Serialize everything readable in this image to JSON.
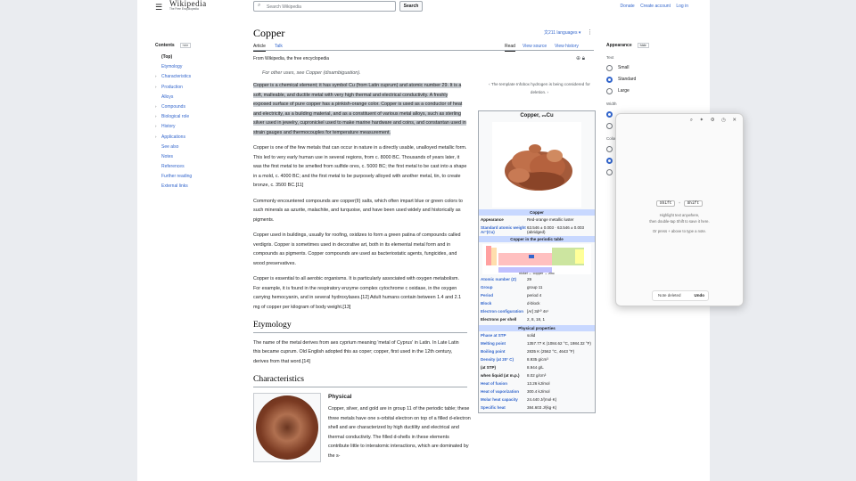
{
  "header": {
    "wordmark": "Wikipedia",
    "tagline": "The Free Encyclopedia",
    "search_placeholder": "Search Wikipedia",
    "search_button": "Search",
    "user_links": [
      "Donate",
      "Create account",
      "Log in"
    ]
  },
  "toc": {
    "title": "Contents",
    "hide": "hide",
    "items": [
      {
        "label": "(Top)",
        "current": true,
        "expandable": false
      },
      {
        "label": "Etymology",
        "expandable": false
      },
      {
        "label": "Characteristics",
        "expandable": true
      },
      {
        "label": "Production",
        "expandable": true
      },
      {
        "label": "Alloys",
        "expandable": false
      },
      {
        "label": "Compounds",
        "expandable": true
      },
      {
        "label": "Biological role",
        "expandable": true
      },
      {
        "label": "History",
        "expandable": true
      },
      {
        "label": "Applications",
        "expandable": true
      },
      {
        "label": "See also",
        "expandable": false
      },
      {
        "label": "Notes",
        "expandable": false
      },
      {
        "label": "References",
        "expandable": false
      },
      {
        "label": "Further reading",
        "expandable": false
      },
      {
        "label": "External links",
        "expandable": false
      }
    ]
  },
  "article": {
    "title": "Copper",
    "languages": "211 languages",
    "tabs_left": [
      "Article",
      "Talk"
    ],
    "tabs_right": [
      "Read",
      "View source",
      "View history"
    ],
    "from": "From Wikipedia, the free encyclopedia",
    "hatnote": "For other uses, see Copper (disambiguation).",
    "p1": "Copper is a chemical element; it has symbol Cu (from Latin cuprum) and atomic number 29. It is a soft, malleable, and ductile metal with very high thermal and electrical conductivity. A freshly exposed surface of pure copper has a pinkish-orange color. Copper is used as a conductor of heat and electricity, as a building material, and as a constituent of various metal alloys, such as sterling silver used in jewelry, cupronickel used to make marine hardware and coins, and constantan used in strain gauges and thermocouples for temperature measurement.",
    "p2": "Copper is one of the few metals that can occur in nature in a directly usable, unalloyed metallic form. This led to very early human use in several regions, from c. 8000 BC. Thousands of years later, it was the first metal to be smelted from sulfide ores, c. 5000 BC; the first metal to be cast into a shape in a mold, c. 4000 BC; and the first metal to be purposely alloyed with another metal, tin, to create bronze, c. 3500 BC.[11]",
    "p3": "Commonly encountered compounds are copper(II) salts, which often impart blue or green colors to such minerals as azurite, malachite, and turquoise, and have been used widely and historically as pigments.",
    "p4": "Copper used in buildings, usually for roofing, oxidizes to form a green patina of compounds called verdigris. Copper is sometimes used in decorative art, both in its elemental metal form and in compounds as pigments. Copper compounds are used as bacteriostatic agents, fungicides, and wood preservatives.",
    "p5": "Copper is essential to all aerobic organisms. It is particularly associated with oxygen metabolism. For example, it is found in the respiratory enzyme complex cytochrome c oxidase, in the oxygen carrying hemocyanin, and in several hydroxylases.[12] Adult humans contain between 1.4 and 2.1 mg of copper per kilogram of body weight.[13]",
    "etym_heading": "Etymology",
    "etym": "The name of the metal derives from aes cyprium meaning 'metal of Cyprus' in Latin. In Late Latin this became cuprum. Old English adopted this as coper; copper, first used in the 12th century, derives from that word.[14]",
    "char_heading": "Characteristics",
    "phys_heading": "Physical",
    "phys": "Copper, silver, and gold are in group 11 of the periodic table; these three metals have one s-orbital electron on top of a filled d-electron shell and are characterized by high ductility and electrical and thermal conductivity. The filled d-shells in these elements contribute little to interatomic interactions, which are dominated by the s-"
  },
  "infobox": {
    "template_note": "‹ The template Infobox hydrogen is being considered for deletion. ›",
    "name": "Copper, ₂₉Cu",
    "bar1": "Copper",
    "rows1": [
      {
        "k": "Appearance",
        "v": "Red-orange metallic luster",
        "plain": true
      },
      {
        "k": "Standard atomic weight Ar°(Cu)",
        "v": "63.546 ± 0.003 · 63.546 ± 0.003 (abridged)"
      }
    ],
    "bar2": "Copper in the periodic table",
    "ptab_caption": "nickel ← copper → zinc",
    "rows2": [
      {
        "k": "Atomic number (Z)",
        "v": "29"
      },
      {
        "k": "Group",
        "v": "group 11"
      },
      {
        "k": "Period",
        "v": "period 4"
      },
      {
        "k": "Block",
        "v": "d-block"
      },
      {
        "k": "Electron configuration",
        "v": "[Ar] 3d¹⁰ 4s¹"
      },
      {
        "k": "Electrons per shell",
        "v": "2, 8, 18, 1",
        "plain": true
      }
    ],
    "bar3": "Physical properties",
    "rows3": [
      {
        "k": "Phase at STP",
        "v": "solid"
      },
      {
        "k": "Melting point",
        "v": "1357.77 K (1084.62 °C, 1984.32 °F)"
      },
      {
        "k": "Boiling point",
        "v": "2835 K (2562 °C, 4643 °F)"
      },
      {
        "k": "Density (at 20° C)",
        "v": "8.935 g/cm³"
      },
      {
        "k": "(at STP)",
        "v": "8.944 g/L",
        "plain": true
      },
      {
        "k": "when liquid (at m.p.)",
        "v": "8.02 g/cm³",
        "plain": true
      },
      {
        "k": "Heat of fusion",
        "v": "13.26 kJ/mol"
      },
      {
        "k": "Heat of vaporization",
        "v": "300.4 kJ/mol"
      },
      {
        "k": "Molar heat capacity",
        "v": "24.440 J/(mol·K)"
      },
      {
        "k": "Specific heat",
        "v": "384.603 J/(kg·K)"
      }
    ]
  },
  "appearance": {
    "title": "Appearance",
    "hide": "hide",
    "text_label": "Text",
    "options": [
      {
        "label": "Small",
        "on": false
      },
      {
        "label": "Standard",
        "on": true
      },
      {
        "label": "Large",
        "on": false
      }
    ],
    "width_label": "Width",
    "color_label": "Color"
  },
  "floating": {
    "toolbar": "⌕ ✦ ⚙ ◷ ✕",
    "key1": "Shift",
    "key_sep": "+",
    "key2": "Shift",
    "hint1": "Highlight text anywhere,",
    "hint2": "then double-tap Shift to save it here.",
    "hint3": "Or press + above to type a note.",
    "toast_msg": "Note deleted",
    "toast_action": "Undo"
  },
  "colors": {
    "link": "#3366cc",
    "highlight": "#c8ccd1",
    "infobox_bar": "#c8d8ff"
  }
}
